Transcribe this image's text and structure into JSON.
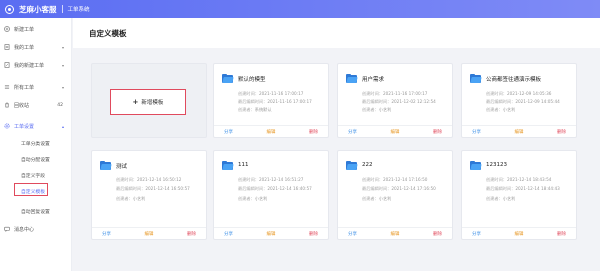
{
  "header": {
    "brand": "芝麻小客服",
    "subsystem": "工单系统"
  },
  "sidebar": {
    "new_ticket": "新建工单",
    "my_tickets": "我的工单",
    "my_created": "我的新建工单",
    "all_tickets": "所有工单",
    "recycle_bin": "回收站",
    "recycle_count": "42",
    "ticket_settings": "工单设置",
    "sub_items": [
      "工单分类设置",
      "自动分配设置",
      "自定义字段",
      "自定义模板",
      "自动回复设置"
    ],
    "message_center": "消息中心"
  },
  "page": {
    "title": "自定义模板",
    "add_label": "新增模板"
  },
  "labels": {
    "created_time": "创建时间：",
    "last_edit_time": "最后编辑时间：",
    "creator": "创建者：",
    "share": "分享",
    "edit": "编辑",
    "delete": "删除"
  },
  "templates": [
    {
      "name": "默认的模型",
      "created": "2021-11-16 17:00:17",
      "edited": "2021-11-16 17:00:17",
      "creator": "系统默认"
    },
    {
      "name": "用户需求",
      "created": "2021-11-16 17:00:17",
      "edited": "2021-12-02 12:12:54",
      "creator": "小艺利"
    },
    {
      "name": "公商都签往通演示模板",
      "created": "2021-12-09 14:05:36",
      "edited": "2021-12-09 14:05:44",
      "creator": "小艺利"
    },
    {
      "name": "测试",
      "created": "2021-12-14 16:50:12",
      "edited": "2021-12-14 16:50:57",
      "creator": "小艺利"
    },
    {
      "name": "111",
      "created": "2021-12-14 16:51:27",
      "edited": "2021-12-14 16:40:57",
      "creator": "小艺利"
    },
    {
      "name": "222",
      "created": "2021-12-14 17:16:50",
      "edited": "2021-12-14 17:16:50",
      "creator": "小艺利"
    },
    {
      "name": "123123",
      "created": "2021-12-14 18:43:54",
      "edited": "2021-12-14 18:44:43",
      "creator": "小艺利"
    }
  ]
}
